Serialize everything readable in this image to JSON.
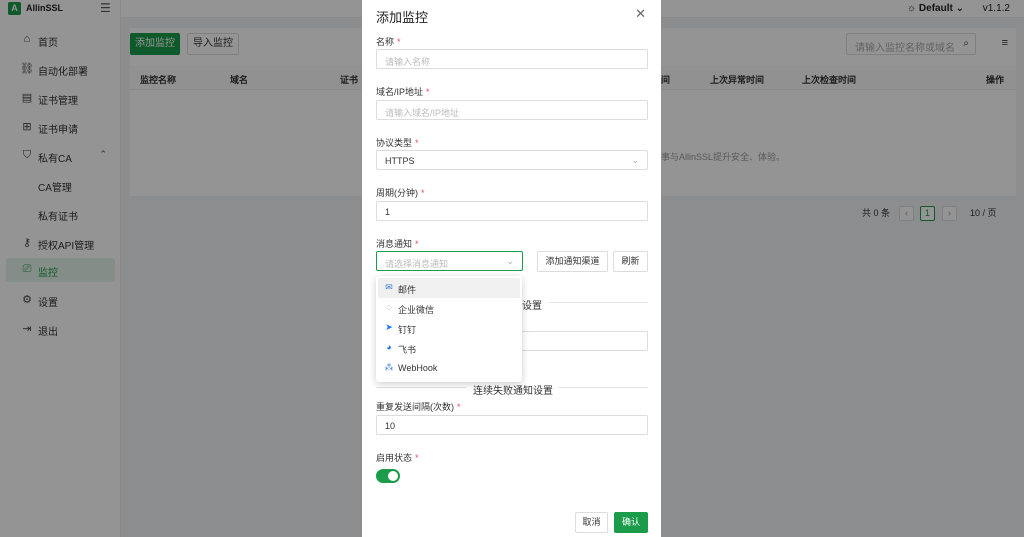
{
  "app": {
    "name": "AllinSSL",
    "logo_letter": "A",
    "theme": "Default",
    "version": "v1.1.2"
  },
  "colors": {
    "accent": "#1a9c4a",
    "required": "#e34d59"
  },
  "sidebar": {
    "items": [
      {
        "label": "首页",
        "icon": "home-icon"
      },
      {
        "label": "自动化部署",
        "icon": "deploy-icon"
      },
      {
        "label": "证书管理",
        "icon": "cert-icon"
      },
      {
        "label": "证书申请",
        "icon": "plus-square-icon"
      },
      {
        "label": "私有CA",
        "icon": "shield-icon"
      },
      {
        "label": "CA管理",
        "icon": ""
      },
      {
        "label": "私有证书",
        "icon": ""
      },
      {
        "label": "授权API管理",
        "icon": "key-icon"
      },
      {
        "label": "监控",
        "icon": "monitor-icon"
      },
      {
        "label": "设置",
        "icon": "gear-icon"
      },
      {
        "label": "退出",
        "icon": "logout-icon"
      }
    ]
  },
  "toolbar": {
    "add_label": "添加监控",
    "import_label": "导入监控",
    "search_placeholder": "请输入监控名称或域名进"
  },
  "table": {
    "headers": [
      "监控名称",
      "域名",
      "证书",
      "间",
      "上次异常时间",
      "上次检查时间",
      "操作"
    ],
    "empty_text": "事与AllinSSL提升安全、体验。"
  },
  "pagination": {
    "total_text": "共 0 条",
    "current_page": "1",
    "page_size": "10 / 页"
  },
  "drawer": {
    "title": "添加监控",
    "name": {
      "label": "名称",
      "placeholder": "请输入名称"
    },
    "domain": {
      "label": "域名/IP地址",
      "placeholder": "请输入域名/IP地址"
    },
    "protocol": {
      "label": "协议类型",
      "value": "HTTPS"
    },
    "period": {
      "label": "周期(分钟)",
      "value": "1"
    },
    "notify": {
      "label": "消息通知",
      "placeholder": "请选择消息通知",
      "add_channel_label": "添加通知渠道",
      "refresh_label": "刷新"
    },
    "section1_title_fragment": "设置",
    "section2_title": "连续失败通知设置",
    "repeat": {
      "label": "重复发送间隔(次数)",
      "value": "10"
    },
    "enable": {
      "label": "启用状态",
      "on": true
    },
    "cancel_label": "取消",
    "confirm_label": "确认"
  },
  "dropdown": {
    "options": [
      {
        "label": "邮件",
        "icon": "mail-icon"
      },
      {
        "label": "企业微信",
        "icon": "wecom-icon"
      },
      {
        "label": "钉钉",
        "icon": "dingtalk-icon"
      },
      {
        "label": "飞书",
        "icon": "feishu-icon"
      },
      {
        "label": "WebHook",
        "icon": "webhook-icon"
      }
    ]
  }
}
